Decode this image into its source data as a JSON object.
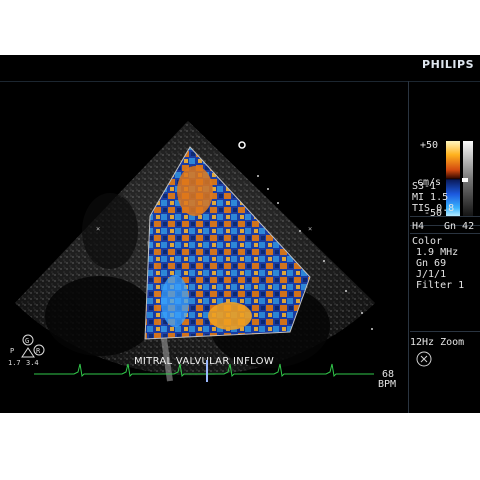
{
  "brand": "PHILIPS",
  "scale": {
    "top": "+50",
    "bottom": "-50",
    "unit": "cm/s"
  },
  "params": {
    "probe": "S3-1",
    "mi": "MI 1.5",
    "tis": "TIS 0.8",
    "harmonic": "H4",
    "gain": "Gn 42",
    "color_mode": "Color",
    "freq": "1.9 MHz",
    "color_gain": "Gn 69",
    "jlines": "J/1/1",
    "filter": "Filter 1"
  },
  "frame_rate": "12Hz",
  "zoom_label": "Zoom",
  "view_label": "MITRAL VALVULAR INFLOW",
  "heart_rate": {
    "value": "68",
    "unit": "BPM"
  },
  "orientation": {
    "p": "P",
    "g": "G",
    "r": "R",
    "angle_a": "1.7",
    "angle_b": "3.4"
  },
  "colors": {
    "ecg": "#31c84a",
    "cursor": "#9ab8ff",
    "rule": "#2a3440"
  }
}
